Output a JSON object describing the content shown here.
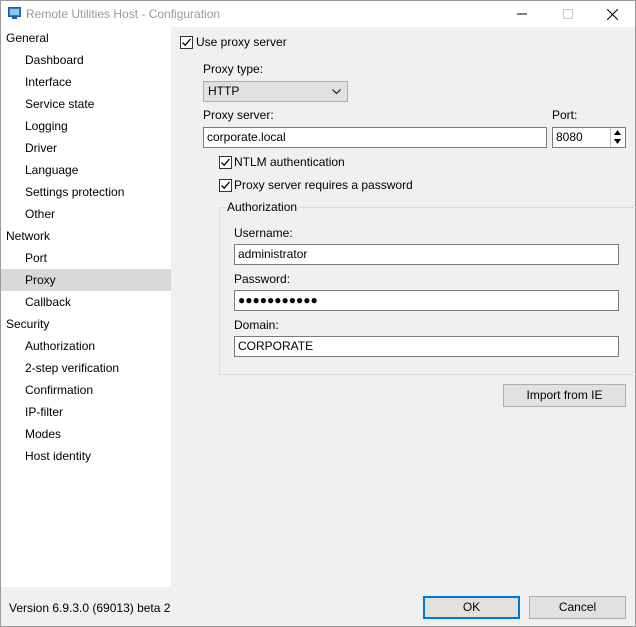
{
  "window": {
    "title": "Remote Utilities Host - Configuration"
  },
  "sidebar": {
    "items": [
      {
        "label": "General",
        "level": 0
      },
      {
        "label": "Dashboard",
        "level": 1
      },
      {
        "label": "Interface",
        "level": 1
      },
      {
        "label": "Service state",
        "level": 1
      },
      {
        "label": "Logging",
        "level": 1
      },
      {
        "label": "Driver",
        "level": 1
      },
      {
        "label": "Language",
        "level": 1
      },
      {
        "label": "Settings protection",
        "level": 1
      },
      {
        "label": "Other",
        "level": 1
      },
      {
        "label": "Network",
        "level": 0
      },
      {
        "label": "Port",
        "level": 1
      },
      {
        "label": "Proxy",
        "level": 1,
        "selected": true
      },
      {
        "label": "Callback",
        "level": 1
      },
      {
        "label": "Security",
        "level": 0
      },
      {
        "label": "Authorization",
        "level": 1
      },
      {
        "label": "2-step verification",
        "level": 1
      },
      {
        "label": "Confirmation",
        "level": 1
      },
      {
        "label": "IP-filter",
        "level": 1
      },
      {
        "label": "Modes",
        "level": 1
      },
      {
        "label": "Host identity",
        "level": 1
      }
    ]
  },
  "proxy": {
    "use_proxy_label": "Use proxy server",
    "use_proxy_checked": true,
    "proxy_type_label": "Proxy type:",
    "proxy_type_value": "HTTP",
    "proxy_server_label": "Proxy server:",
    "proxy_server_value": "corporate.local",
    "port_label": "Port:",
    "port_value": "8080",
    "ntlm_label": "NTLM authentication",
    "ntlm_checked": true,
    "requires_password_label": "Proxy server requires a password",
    "requires_password_checked": true,
    "auth_group_label": "Authorization",
    "username_label": "Username:",
    "username_value": "administrator",
    "password_label": "Password:",
    "password_value": "●●●●●●●●●●●",
    "domain_label": "Domain:",
    "domain_value": "CORPORATE",
    "import_button_label": "Import from IE"
  },
  "footer": {
    "version": "Version 6.9.3.0 (69013) beta 2",
    "ok_label": "OK",
    "cancel_label": "Cancel"
  },
  "colors": {
    "selected_bg": "#d9d9d9",
    "accent": "#0078d7",
    "panel_bg": "#f0f0f0"
  }
}
